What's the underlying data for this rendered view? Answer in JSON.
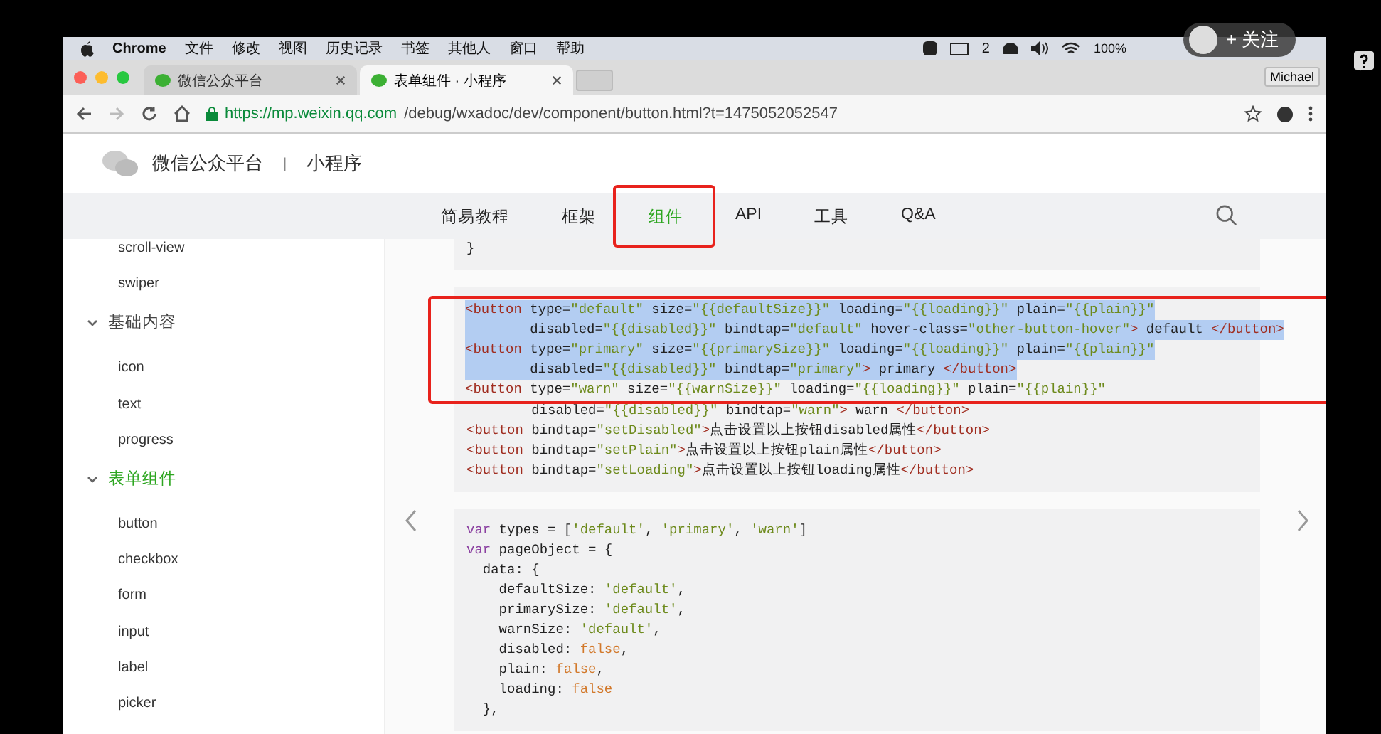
{
  "menu_bar": {
    "app": "Chrome",
    "items": [
      "文件",
      "修改",
      "视图",
      "历史记录",
      "书签",
      "其他人",
      "窗口",
      "帮助"
    ],
    "status": {
      "badge": "2",
      "battery": "100%"
    }
  },
  "tabs": [
    {
      "label": "微信公众平台",
      "selected": false
    },
    {
      "label": "表单组件 · 小程序",
      "selected": true
    }
  ],
  "profile": "Michael",
  "address": {
    "host": "https://mp.weixin.qq.com",
    "path": "/debug/wxadoc/dev/component/button.html?t=1475052052547"
  },
  "site": {
    "name": "微信公众平台",
    "separator": "|",
    "section": "小程序"
  },
  "nav": [
    {
      "label": "简易教程",
      "selected": false,
      "highlighted": false
    },
    {
      "label": "框架",
      "selected": false,
      "highlighted": false
    },
    {
      "label": "组件",
      "selected": true,
      "highlighted": true
    },
    {
      "label": "API",
      "selected": false,
      "highlighted": false
    },
    {
      "label": "工具",
      "selected": false,
      "highlighted": false
    },
    {
      "label": "Q&A",
      "selected": false,
      "highlighted": false
    }
  ],
  "sidebar": [
    {
      "kind": "item",
      "label": "scroll-view"
    },
    {
      "kind": "item",
      "label": "swiper"
    },
    {
      "kind": "group",
      "label": "基础内容",
      "selected": false,
      "expanded": true,
      "children": [
        {
          "kind": "item",
          "label": "icon"
        },
        {
          "kind": "item",
          "label": "text"
        },
        {
          "kind": "item",
          "label": "progress"
        }
      ]
    },
    {
      "kind": "group",
      "label": "表单组件",
      "selected": true,
      "expanded": true,
      "children": [
        {
          "kind": "item",
          "label": "button"
        },
        {
          "kind": "item",
          "label": "checkbox"
        },
        {
          "kind": "item",
          "label": "form"
        },
        {
          "kind": "item",
          "label": "input"
        },
        {
          "kind": "item",
          "label": "label"
        },
        {
          "kind": "item",
          "label": "picker"
        }
      ]
    }
  ],
  "code_blocks": [
    {
      "lines": [
        {
          "text": "}",
          "selected": false,
          "highlighted": false
        }
      ]
    },
    {
      "lines": [
        {
          "text": "<button type=\"default\" size=\"{{defaultSize}}\" loading=\"{{loading}}\" plain=\"{{plain}}\"",
          "selected": true,
          "highlighted": true
        },
        {
          "text": "        disabled=\"{{disabled}}\" bindtap=\"default\" hover-class=\"other-button-hover\"> default </button>",
          "selected": true,
          "highlighted": true
        },
        {
          "text": "<button type=\"primary\" size=\"{{primarySize}}\" loading=\"{{loading}}\" plain=\"{{plain}}\"",
          "selected": true,
          "highlighted": true
        },
        {
          "text": "        disabled=\"{{disabled}}\" bindtap=\"primary\"> primary </button>",
          "selected": true,
          "highlighted": true
        },
        {
          "text": "<button type=\"warn\" size=\"{{warnSize}}\" loading=\"{{loading}}\" plain=\"{{plain}}\"",
          "selected": false,
          "highlighted": true
        },
        {
          "text": "        disabled=\"{{disabled}}\" bindtap=\"warn\"> warn </button>",
          "selected": false,
          "highlighted": false
        },
        {
          "text": "<button bindtap=\"setDisabled\">点击设置以上按钮disabled属性</button>",
          "selected": false,
          "highlighted": false
        },
        {
          "text": "<button bindtap=\"setPlain\">点击设置以上按钮plain属性</button>",
          "selected": false,
          "highlighted": false
        },
        {
          "text": "<button bindtap=\"setLoading\">点击设置以上按钮loading属性</button>",
          "selected": false,
          "highlighted": false
        }
      ]
    },
    {
      "lines": [
        {
          "text": "var types = ['default', 'primary', 'warn']",
          "selected": false,
          "highlighted": false
        },
        {
          "text": "var pageObject = {",
          "selected": false,
          "highlighted": false
        },
        {
          "text": "  data: {",
          "selected": false,
          "highlighted": false
        },
        {
          "text": "    defaultSize: 'default',",
          "selected": false,
          "highlighted": false
        },
        {
          "text": "    primarySize: 'default',",
          "selected": false,
          "highlighted": false
        },
        {
          "text": "    warnSize: 'default',",
          "selected": false,
          "highlighted": false
        },
        {
          "text": "    disabled: false,",
          "selected": false,
          "highlighted": false
        },
        {
          "text": "    plain: false,",
          "selected": false,
          "highlighted": false
        },
        {
          "text": "    loading: false",
          "selected": false,
          "highlighted": false
        },
        {
          "text": "  },",
          "selected": false,
          "highlighted": false
        }
      ]
    }
  ],
  "follow_button": "+ 关注"
}
